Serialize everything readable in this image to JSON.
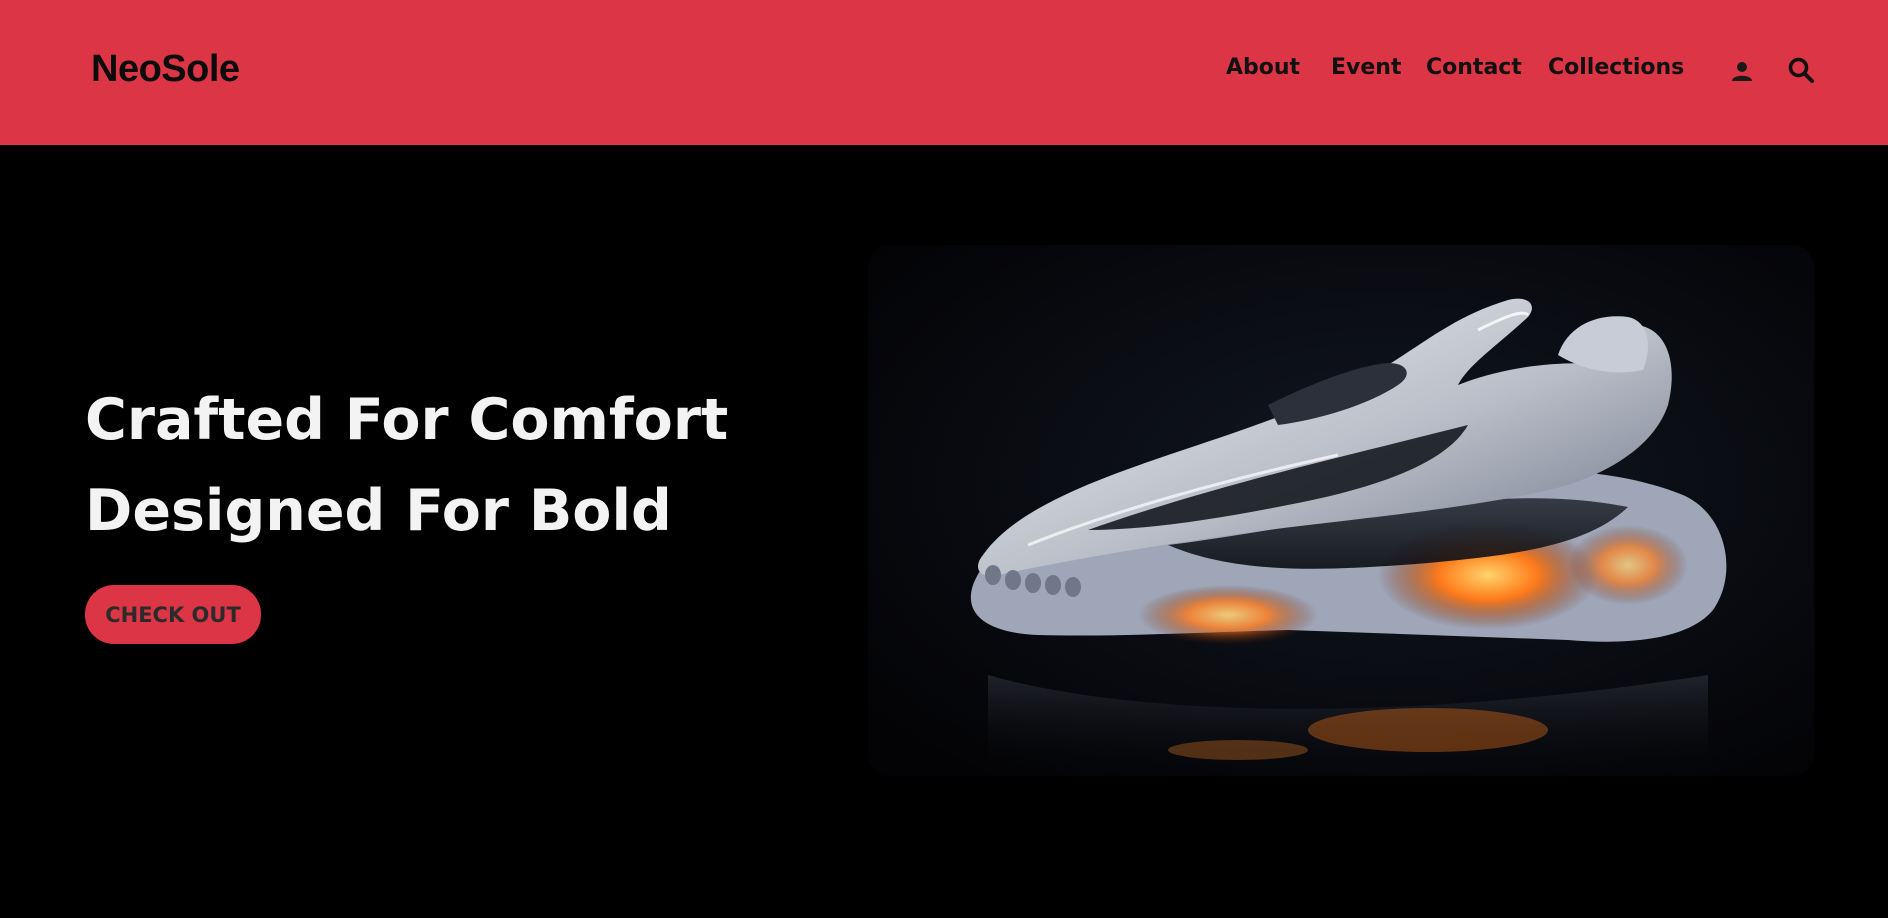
{
  "brand": {
    "logo_text": "NeoSole"
  },
  "nav": {
    "links": [
      {
        "label": "About"
      },
      {
        "label": "Event"
      },
      {
        "label": "Contact"
      },
      {
        "label": "Collections"
      }
    ],
    "icons": [
      "user-icon",
      "search-icon"
    ]
  },
  "hero": {
    "title_line1": "Crafted For Comfort",
    "title_line2": "Designed For Bold",
    "cta_label": "CHECK OUT",
    "image_alt": "sneaker-image"
  },
  "colors": {
    "accent": "#dc3545",
    "background": "#000000",
    "heading_text": "#f3f3f3",
    "nav_text": "#111111"
  }
}
